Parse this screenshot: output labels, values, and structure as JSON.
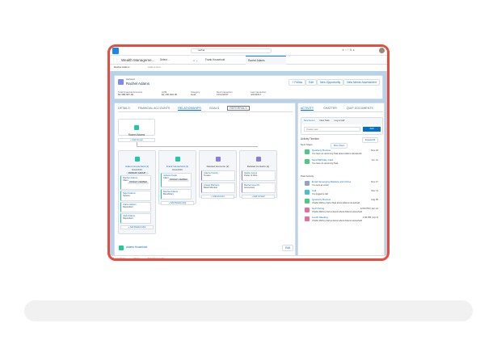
{
  "header": {
    "search_value": "rachel"
  },
  "nav": {
    "app_name": "Wealth Manageme...",
    "select": "Select...",
    "tabs": [
      {
        "label": "Frank Household"
      },
      {
        "label": "Rachel Adams"
      }
    ]
  },
  "subtabs": [
    {
      "label": "Rachel Adams"
    },
    {
      "label": "Adams Hou..."
    }
  ],
  "record": {
    "type": "Account",
    "name": "Rachel Adams",
    "actions": [
      "+ Follow",
      "Edit",
      "New Opportunity",
      "New Needs Assessment"
    ],
    "fields": [
      {
        "label": "Total Financial Accounts",
        "value": "$4,388,587.00"
      },
      {
        "label": "AUM",
        "value": "$1,150,000.00"
      },
      {
        "label": "Category",
        "value": "Gold"
      },
      {
        "label": "Next Interaction",
        "value": "11/11/2017"
      },
      {
        "label": "Last Interaction",
        "value": "4/24/2017"
      }
    ]
  },
  "main_tabs": [
    "DETAILS",
    "FINANCIAL ACCOUNTS",
    "RELATIONSHIPS",
    "GOALS",
    "REFERRALS"
  ],
  "relationships": {
    "root": "Rachel Adams",
    "add_group": "+ Add Group",
    "groups": [
      {
        "title": "Adams Household (4)",
        "sub": "Household",
        "badge": "PRIMARY GROUP",
        "members": [
          {
            "name": "Rachel Adams",
            "role": "Client",
            "badge": "PRIMARY MEMBER"
          },
          {
            "name": "Nigel Adams",
            "role": "Spouse"
          },
          {
            "name": "Claire Adams",
            "role": "Dependent"
          },
          {
            "name": "Jack Adams",
            "role": "Dependent"
          }
        ],
        "add": "+ Add Relationship"
      },
      {
        "title": "Frank Household (2)",
        "sub": "Household",
        "members": [
          {
            "name": "Juliana Frank",
            "role": "Client",
            "badge": "PRIMARY MEMBER"
          },
          {
            "name": "Rachel Adams",
            "role": "Beneficiary"
          }
        ],
        "add": "+ Add Relationship"
      },
      {
        "title": "Related Accounts (2)",
        "members": [
          {
            "name": "Adams Family ...",
            "role": "Trustee"
          },
          {
            "name": "United Partners",
            "role": "Board Member"
          }
        ],
        "add": "+ Add Account"
      },
      {
        "title": "Related Contacts (2)",
        "members": [
          {
            "name": "Jackie Jones",
            "role": "Power of Attor..."
          },
          {
            "name": "Rachel Greenfi...",
            "role": "Accountant"
          }
        ],
        "add": "+ Add Contact"
      }
    ],
    "footer_title": "Adams Household",
    "footer_edit": "Edit"
  },
  "activity": {
    "tabs": [
      "ACTIVITY",
      "CHATTER",
      "QUIP DOCUMENTS"
    ],
    "composer_tabs": [
      "New Event",
      "New Task",
      "Log a Call"
    ],
    "input_placeholder": "Create new...",
    "add": "Add",
    "timeline": "Activity Timeline",
    "expand": "Expand All",
    "next_steps": "Next Steps",
    "more_steps": "More Steps",
    "past": "Past Activity",
    "next": [
      {
        "title": "Quarterly Review",
        "date": "Nov 24",
        "desc": "You have an upcoming Task about Adams Household",
        "color": "green",
        "overdue": false
      },
      {
        "title": "Send Birthday Card",
        "date": "Apr 22",
        "desc": "You have an upcoming Task",
        "color": "green",
        "overdue": true
      }
    ],
    "past_items": [
      {
        "title": "Email: Emerging Markets and China",
        "date": "Nov 17",
        "desc": "You sent an email",
        "color": "grey"
      },
      {
        "title": "Call",
        "date": "Nov 11",
        "desc": "You logged a call",
        "color": "cyan"
      },
      {
        "title": "Quarterly Review",
        "date": "Aug 25",
        "desc": "Charlie Richey had a Task about Adams Household",
        "color": "green"
      },
      {
        "title": "Golf Outing",
        "date": "12:00 PM | Apr 14",
        "desc": "Charlie Richey had an Event about Adams Household",
        "color": "pink"
      },
      {
        "title": "Lunch Meeting",
        "date": "1:00 PM | Apr 9",
        "desc": "Charlie Richey had an Event about Adams Household",
        "color": "pink"
      }
    ]
  },
  "utility": [
    "Recent Items",
    "Notes",
    "Quip Documents"
  ]
}
